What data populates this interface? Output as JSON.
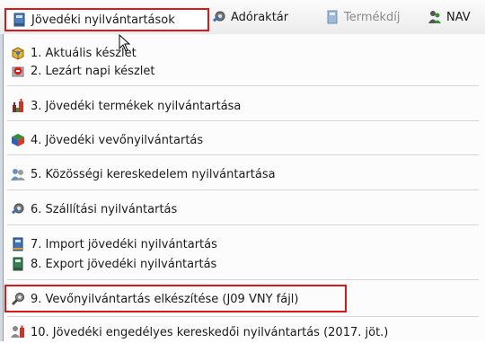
{
  "menubar": {
    "items": [
      {
        "label": "Jövedéki nyilvántartások",
        "icon": "book-icon",
        "active": true
      },
      {
        "label": "Adóraktár",
        "icon": "gear-icon"
      },
      {
        "label": "Termékdíj",
        "icon": "green-book-icon",
        "disabled": true
      },
      {
        "label": "NAV",
        "icon": "users-icon"
      }
    ]
  },
  "dropdown": {
    "items": [
      {
        "label": "1. Aktuális készlet",
        "icon": "box-icon"
      },
      {
        "label": "2. Lezárt napi készlet",
        "icon": "stop-icon"
      },
      {
        "label": "3. Jövedéki termékek nyilvántartása",
        "icon": "bottles-icon"
      },
      {
        "label": "4. Jövedéki vevőnyilvántartás",
        "icon": "cube-icon"
      },
      {
        "label": "5. Közösségi kereskedelem nyilvántartása",
        "icon": "people-icon"
      },
      {
        "label": "6. Szállítási nyilvántartás",
        "icon": "gear-icon"
      },
      {
        "label": "7. Import jövedéki nyilvántartás",
        "icon": "import-book-icon"
      },
      {
        "label": "8. Export jövedéki nyilvántartás",
        "icon": "export-book-icon"
      },
      {
        "label": "9. Vevőnyilvántartás elkészítése (J09 VNY fájl)",
        "icon": "tool-icon",
        "highlighted": true
      },
      {
        "label": "10. Jövedéki engedélyes kereskedői nyilvántartás (2017. jöt.)",
        "icon": "trader-icon"
      }
    ]
  },
  "colors": {
    "highlight": "#d7191c",
    "menubar_bg": "#efefef"
  }
}
